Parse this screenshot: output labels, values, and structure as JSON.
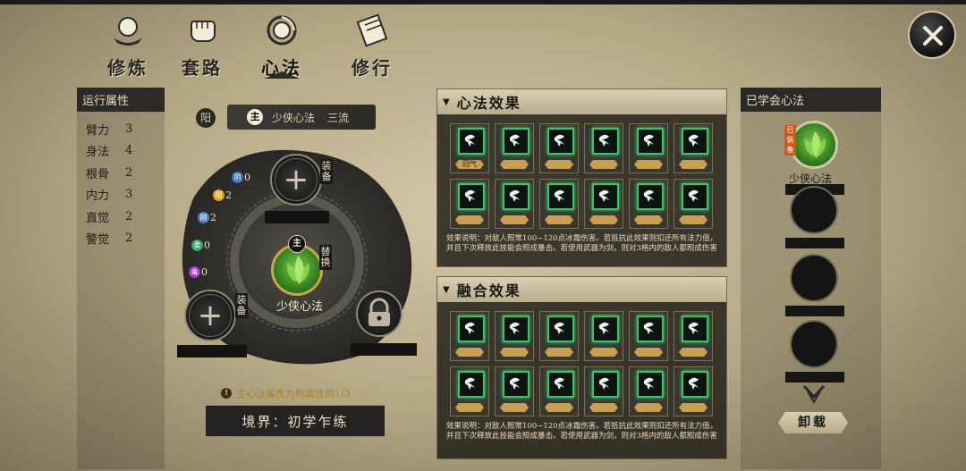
{
  "tabs": [
    {
      "label": "修炼"
    },
    {
      "label": "套路"
    },
    {
      "label": "心法",
      "active": true
    },
    {
      "label": "修行"
    }
  ],
  "attributes": {
    "header": "运行属性",
    "items": [
      {
        "name": "臂力",
        "value": "3"
      },
      {
        "name": "身法",
        "value": "4"
      },
      {
        "name": "根骨",
        "value": "2"
      },
      {
        "name": "内力",
        "value": "3"
      },
      {
        "name": "直觉",
        "value": "2"
      },
      {
        "name": "警觉",
        "value": "2"
      }
    ]
  },
  "main_method": {
    "yang_label": "阳",
    "main_badge": "主",
    "name": "少侠心法",
    "grade": "三流"
  },
  "wheel": {
    "stats": [
      {
        "icon": "阴",
        "value": "0",
        "color": "#3a6fc7"
      },
      {
        "icon": "阳",
        "value": "2",
        "color": "#e0a02a"
      },
      {
        "icon": "刚",
        "value": "2",
        "color": "#4f7fc8"
      },
      {
        "icon": "柔",
        "value": "0",
        "color": "#3aa36a"
      },
      {
        "icon": "毒",
        "value": "0",
        "color": "#a03cc7"
      }
    ],
    "equip_label": "装备",
    "replace_label": "替换",
    "center_badge": "主",
    "center_name": "少侠心法"
  },
  "warning": "主心法属性为附属性的1/3",
  "realm": "境界：初学乍练",
  "effects": {
    "title": "心法效果",
    "first_tag": "回气",
    "desc": "效果说明：对敌人照常100~120点冰霜伤害。若抵抗此效果则扣还所有法力值，并且下次释放此技能会照成暴击。若使用武器为剑，则对3格内的敌人都照成伤害"
  },
  "fusion": {
    "title": "融合效果",
    "desc": "效果说明：对敌人照常100~120点冰霜伤害。若抵抗此效果则扣还所有法力值，并且下次释放此技能会照成暴击。若使用武器为剑，则对3格内的敌人都照成伤害"
  },
  "learned": {
    "header": "已学会心法",
    "equipped_tag": "已装备",
    "skill_name": "少侠心法",
    "unload_label": "卸载"
  },
  "colors": {
    "accent_green": "#37c46a",
    "gold": "#c69f53",
    "equipped_orange": "#d4561b"
  }
}
